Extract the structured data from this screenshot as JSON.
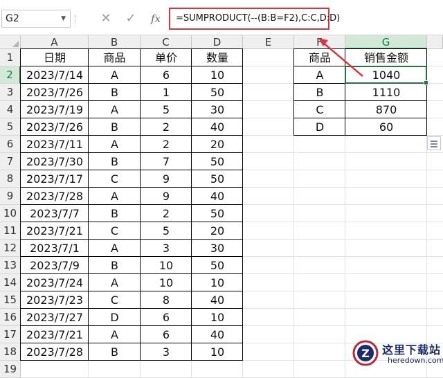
{
  "formula_bar": {
    "name_box": "G2",
    "cancel_symbol": "✕",
    "enter_symbol": "✓",
    "fx_label": "fx",
    "formula": "=SUMPRODUCT(--(B:B=F2),C:C,D:D)"
  },
  "columns": [
    "A",
    "B",
    "C",
    "D",
    "E",
    "F",
    "G"
  ],
  "rows": [
    "1",
    "2",
    "3",
    "4",
    "5",
    "6",
    "7",
    "8",
    "9",
    "10",
    "11",
    "12",
    "13",
    "14",
    "15",
    "16",
    "17",
    "18",
    "19"
  ],
  "table_main": {
    "headers": [
      "日期",
      "商品",
      "单价",
      "数量"
    ],
    "rows": [
      [
        "2023/7/14",
        "A",
        "6",
        "10"
      ],
      [
        "2023/7/26",
        "B",
        "1",
        "50"
      ],
      [
        "2023/7/19",
        "A",
        "5",
        "30"
      ],
      [
        "2023/7/26",
        "B",
        "2",
        "40"
      ],
      [
        "2023/7/11",
        "A",
        "2",
        "20"
      ],
      [
        "2023/7/30",
        "B",
        "7",
        "50"
      ],
      [
        "2023/7/17",
        "C",
        "9",
        "50"
      ],
      [
        "2023/7/28",
        "A",
        "9",
        "40"
      ],
      [
        "2023/7/7",
        "B",
        "2",
        "50"
      ],
      [
        "2023/7/21",
        "C",
        "5",
        "20"
      ],
      [
        "2023/7/1",
        "A",
        "3",
        "30"
      ],
      [
        "2023/7/9",
        "B",
        "10",
        "50"
      ],
      [
        "2023/7/24",
        "A",
        "10",
        "10"
      ],
      [
        "2023/7/23",
        "C",
        "8",
        "40"
      ],
      [
        "2023/7/27",
        "D",
        "6",
        "10"
      ],
      [
        "2023/7/21",
        "A",
        "6",
        "40"
      ],
      [
        "2023/7/28",
        "B",
        "3",
        "10"
      ]
    ]
  },
  "table_summary": {
    "headers": [
      "商品",
      "销售金额"
    ],
    "rows": [
      [
        "A",
        "1040"
      ],
      [
        "B",
        "1110"
      ],
      [
        "C",
        "870"
      ],
      [
        "D",
        "60"
      ]
    ]
  },
  "selected_cell": "G2",
  "watermark": {
    "title": "这里下载站",
    "url": "heredown.com",
    "logo_letter": "Z"
  },
  "colors": {
    "selection": "#217346",
    "formula_highlight": "#d9363e",
    "header_bg": "#efefef"
  }
}
